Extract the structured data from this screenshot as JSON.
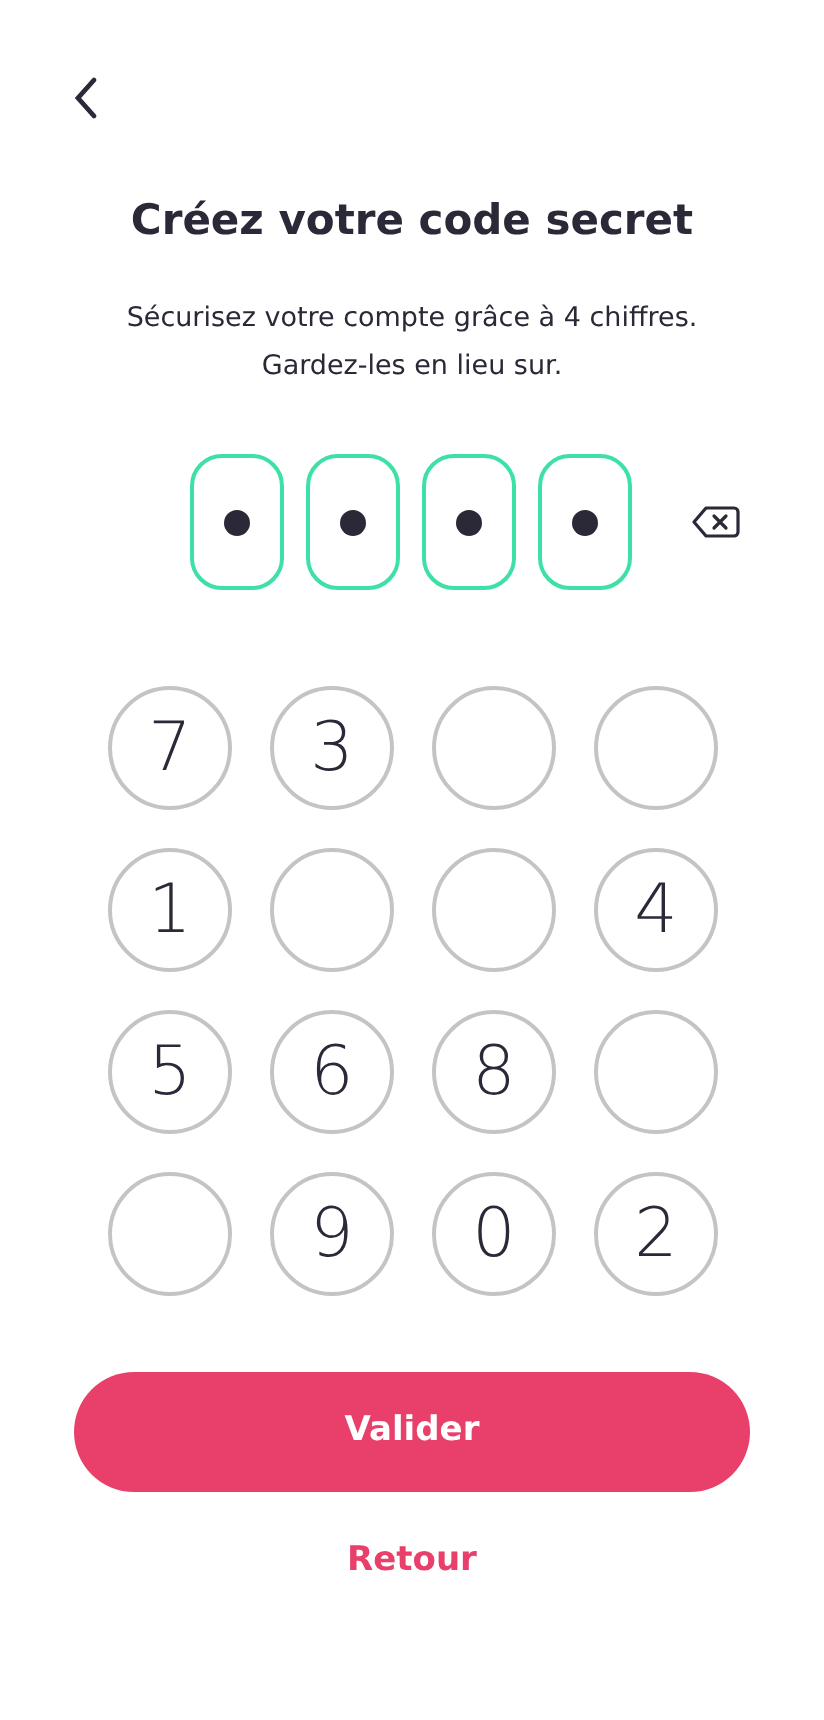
{
  "title": "Créez votre code secret",
  "subtitle_lines": [
    "Sécurisez votre compte grâce à 4 chiffres.",
    "Gardez-les en lieu sur."
  ],
  "pin_slots": [
    {
      "filled": true
    },
    {
      "filled": true
    },
    {
      "filled": true
    },
    {
      "filled": true
    }
  ],
  "keypad": [
    {
      "kind": "digit",
      "label": "7"
    },
    {
      "kind": "digit",
      "label": "3"
    },
    {
      "kind": "blank"
    },
    {
      "kind": "blank"
    },
    {
      "kind": "digit",
      "label": "1"
    },
    {
      "kind": "blank"
    },
    {
      "kind": "blank"
    },
    {
      "kind": "digit",
      "label": "4"
    },
    {
      "kind": "digit",
      "label": "5"
    },
    {
      "kind": "digit",
      "label": "6"
    },
    {
      "kind": "digit",
      "label": "8"
    },
    {
      "kind": "blank"
    },
    {
      "kind": "blank"
    },
    {
      "kind": "digit",
      "label": "9"
    },
    {
      "kind": "digit",
      "label": "0"
    },
    {
      "kind": "digit",
      "label": "2"
    }
  ],
  "primary_button": "Valider",
  "secondary_link": "Retour"
}
